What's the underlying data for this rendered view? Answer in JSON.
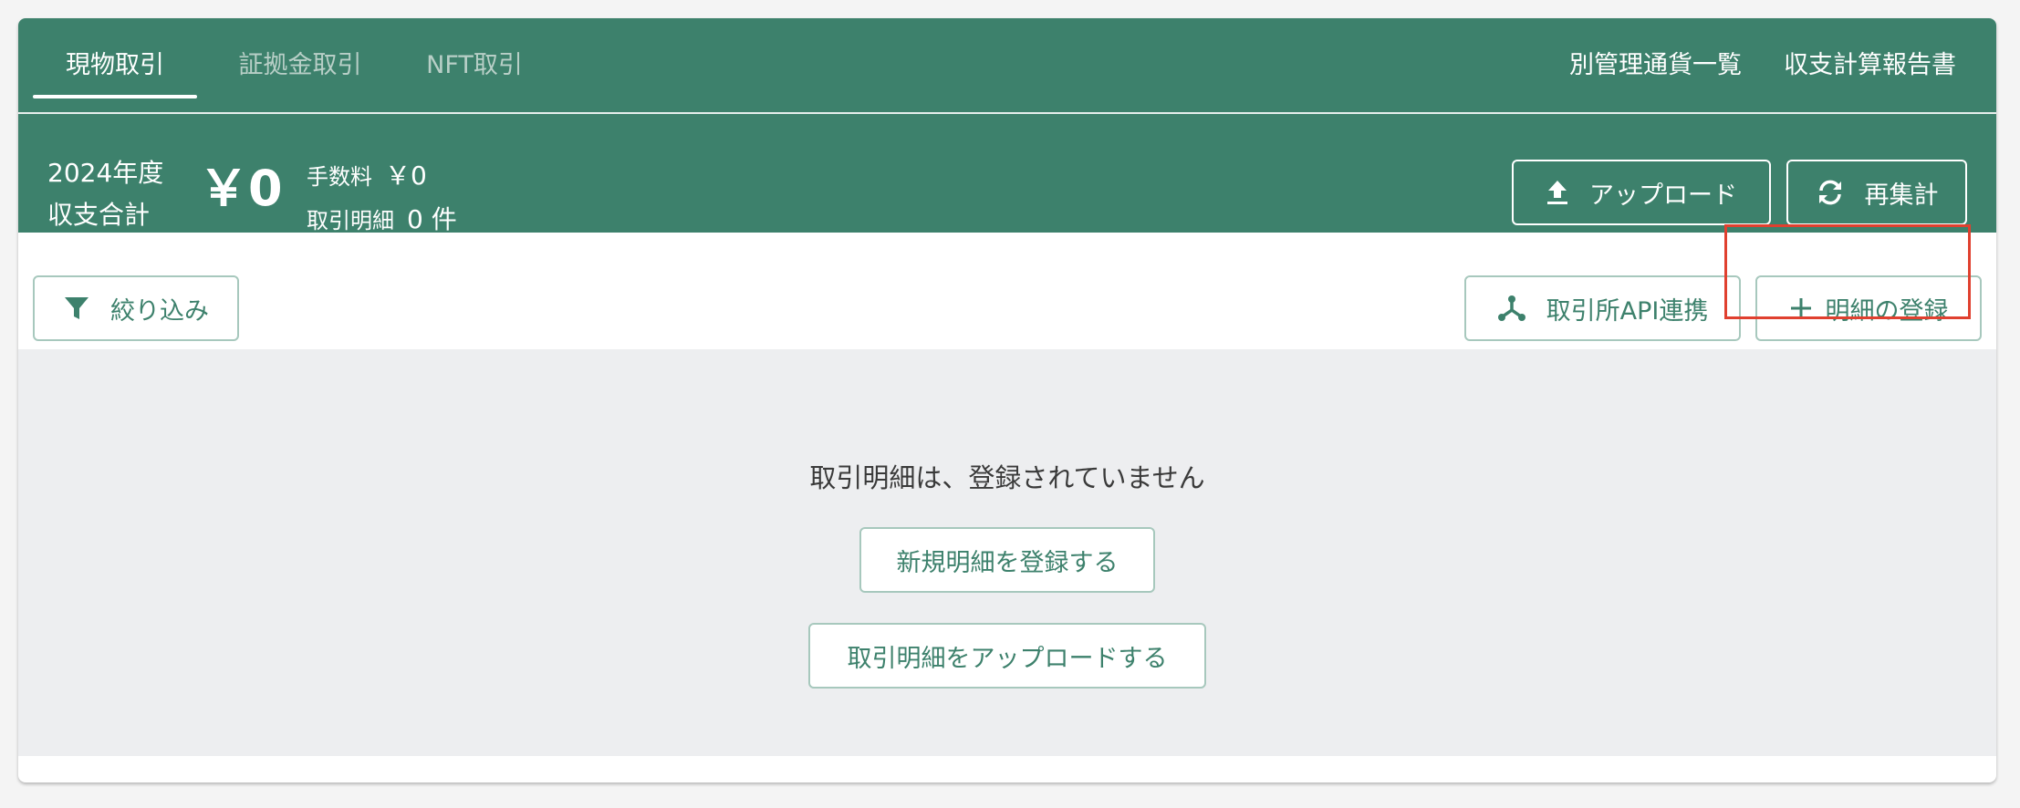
{
  "tabs": [
    {
      "label": "現物取引",
      "active": true
    },
    {
      "label": "証拠金取引",
      "active": false
    },
    {
      "label": "NFT取引",
      "active": false
    }
  ],
  "top_links": [
    "別管理通貨一覧",
    "収支計算報告書"
  ],
  "summary": {
    "year": "2024年度",
    "total_label": "収支合計",
    "total_amount": "￥0",
    "fee_label": "手数料",
    "fee_value": "￥0",
    "count_label": "取引明細",
    "count_value": "0 件"
  },
  "actions": {
    "upload": "アップロード",
    "recalculate": "再集計",
    "filter": "絞り込み",
    "exchange_api": "取引所API連携",
    "add_detail": "明細の登録"
  },
  "empty_state": {
    "message": "取引明細は、登録されていません",
    "register_new": "新規明細を登録する",
    "upload_details": "取引明細をアップロードする"
  },
  "colors": {
    "brand": "#3d816c",
    "highlight": "#e0402f",
    "empty_bg": "#edeef0"
  },
  "icons": {
    "upload": "upload-icon",
    "refresh": "refresh-icon",
    "filter": "filter-icon",
    "api": "api-connect-icon",
    "plus": "plus-icon"
  }
}
